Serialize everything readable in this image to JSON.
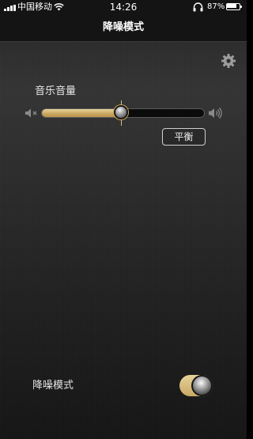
{
  "status_bar": {
    "carrier": "中国移动",
    "time": "14:26",
    "battery_percent": "87%",
    "battery_level": 0.87,
    "signal_bars": 4
  },
  "navbar": {
    "title": "降噪模式"
  },
  "settings": {
    "icon": "gear-icon"
  },
  "volume": {
    "label": "音乐音量",
    "value": 0.5,
    "min_icon": "speaker-mute-icon",
    "max_icon": "speaker-loud-icon",
    "balance_label": "平衡"
  },
  "noise_mode": {
    "label": "降噪模式",
    "enabled": true
  },
  "colors": {
    "accent_gold": "#c9a864",
    "background": "#141414"
  }
}
